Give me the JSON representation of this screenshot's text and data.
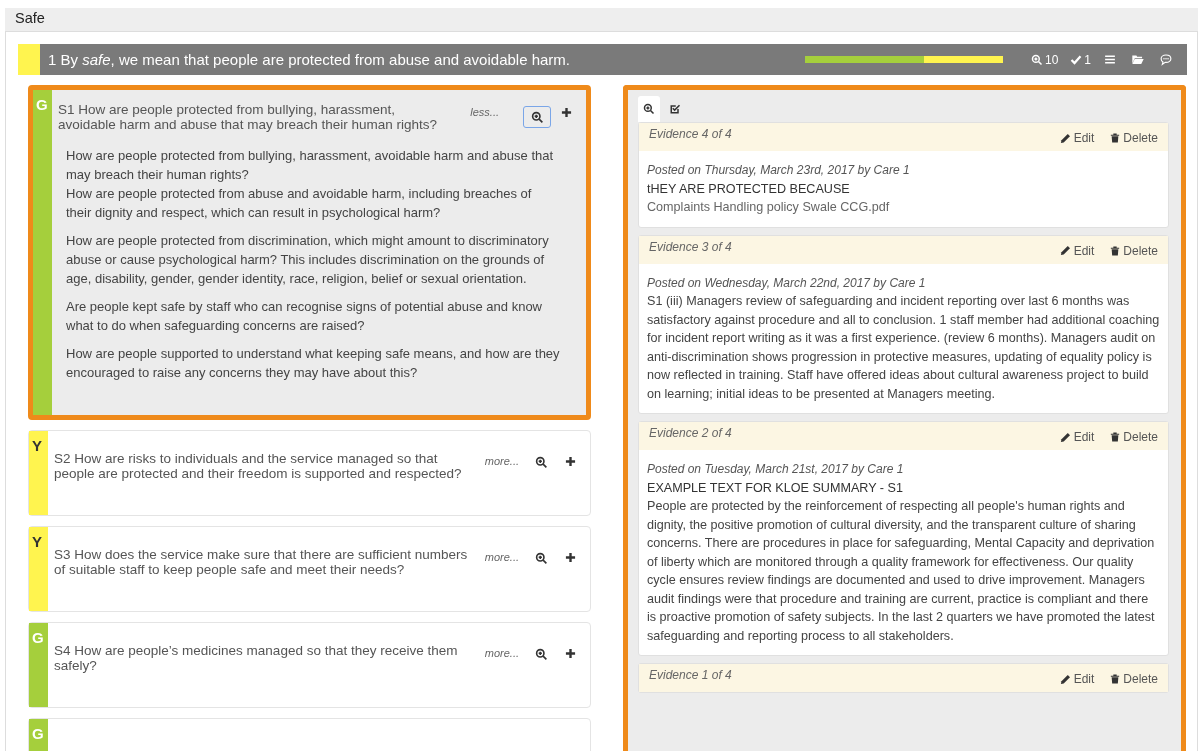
{
  "section_title": "Safe",
  "header": {
    "color": "#fff44f",
    "title": "1 By *safe*, we mean that people are protected from abuse and avoidable harm.",
    "progress": [
      {
        "color": "#a5cf3c",
        "level": 0.6
      },
      {
        "color": "#fff44f",
        "level": 0.4
      }
    ],
    "evidence_count": "10",
    "checked_count": "1"
  },
  "questions": [
    {
      "rating": "G",
      "color": "#a5cf3c",
      "selected": true,
      "expanded": true,
      "toggle": "less...",
      "zoom_active": true,
      "text": "S1 How are people protected from bullying, harassment, avoidable harm and abuse that may breach their human rights?",
      "details": [
        [
          "How are people protected from bullying, harassment, avoidable harm and abuse that may breach their human rights?",
          "How are people protected from abuse and avoidable harm, including breaches of their dignity and respect, which can result in psychological harm?"
        ],
        [
          "How are people protected from discrimination, which might amount to discriminatory abuse or cause psychological harm? This includes discrimination on the grounds of age, disability, gender, gender identity, race, religion, belief or sexual orientation."
        ],
        [
          "Are people kept safe by staff who can recognise signs of potential abuse and know what to do when safeguarding concerns are raised?"
        ],
        [
          "How are people supported to understand what keeping safe means, and how are they encouraged to raise any concerns they may have about this?"
        ]
      ]
    },
    {
      "rating": "Y",
      "color": "#fff44f",
      "selected": false,
      "expanded": false,
      "toggle": "more...",
      "zoom_active": false,
      "text": "S2 How are risks to individuals and the service managed so that people are protected and their freedom is supported and respected?"
    },
    {
      "rating": "Y",
      "color": "#fff44f",
      "selected": false,
      "expanded": false,
      "toggle": "more...",
      "zoom_active": false,
      "text": "S3 How does the service make sure that there are sufficient numbers of suitable staff to keep people safe and meet their needs?"
    },
    {
      "rating": "G",
      "color": "#a5cf3c",
      "selected": false,
      "expanded": false,
      "toggle": "more...",
      "zoom_active": false,
      "text": "S4 How are people’s medicines managed so that they receive them safely?"
    },
    {
      "rating": "G",
      "color": "#a5cf3c",
      "selected": false,
      "expanded": false
    }
  ],
  "evidence_tabs": [
    {
      "kind": "evidence",
      "selected": true
    },
    {
      "kind": "checklist",
      "selected": false
    }
  ],
  "evidence": [
    {
      "label": "Evidence 4 of 4",
      "edit": "Edit",
      "delete": "Delete",
      "posted": "Posted on Thursday, March 23rd, 2017 by Care 1",
      "heading": "tHEY ARE PROTECTED BECAUSE",
      "attachment": "Complaints Handling policy Swale CCG.pdf"
    },
    {
      "label": "Evidence 3 of 4",
      "edit": "Edit",
      "delete": "Delete",
      "posted": "Posted on Wednesday, March 22nd, 2017 by Care 1",
      "body": "S1 (iii) Managers review of safeguarding and incident reporting over last 6 months was satisfactory against procedure and all to conclusion. 1 staff member had additional coaching for incident report writing as it was a first experience. (review 6 months). Managers audit on anti-discrimination shows progression in protective measures, updating of equality policy is now reflected in training. Staff have offered ideas about cultural awareness project to build on learning; initial ideas to be presented at Managers meeting."
    },
    {
      "label": "Evidence 2 of 4",
      "edit": "Edit",
      "delete": "Delete",
      "posted": "Posted on Tuesday, March 21st, 2017 by Care 1",
      "heading": "EXAMPLE TEXT FOR KLOE SUMMARY - S1",
      "body": "People are protected by the reinforcement of respecting all people's human rights and dignity, the positive promotion of cultural diversity, and the transparent culture of sharing concerns. There are procedures in place for safeguarding, Mental Capacity and deprivation of liberty which are monitored through a quality framework for effectiveness. Our quality cycle ensures review findings are documented and used to drive improvement. Managers audit findings were that procedure and training are current, practice is compliant and there is proactive promotion of safety subjects. In the last 2 quarters we have promoted the latest safeguarding and reporting process to all stakeholders."
    },
    {
      "label": "Evidence 1 of 4",
      "edit": "Edit",
      "delete": "Delete"
    }
  ]
}
